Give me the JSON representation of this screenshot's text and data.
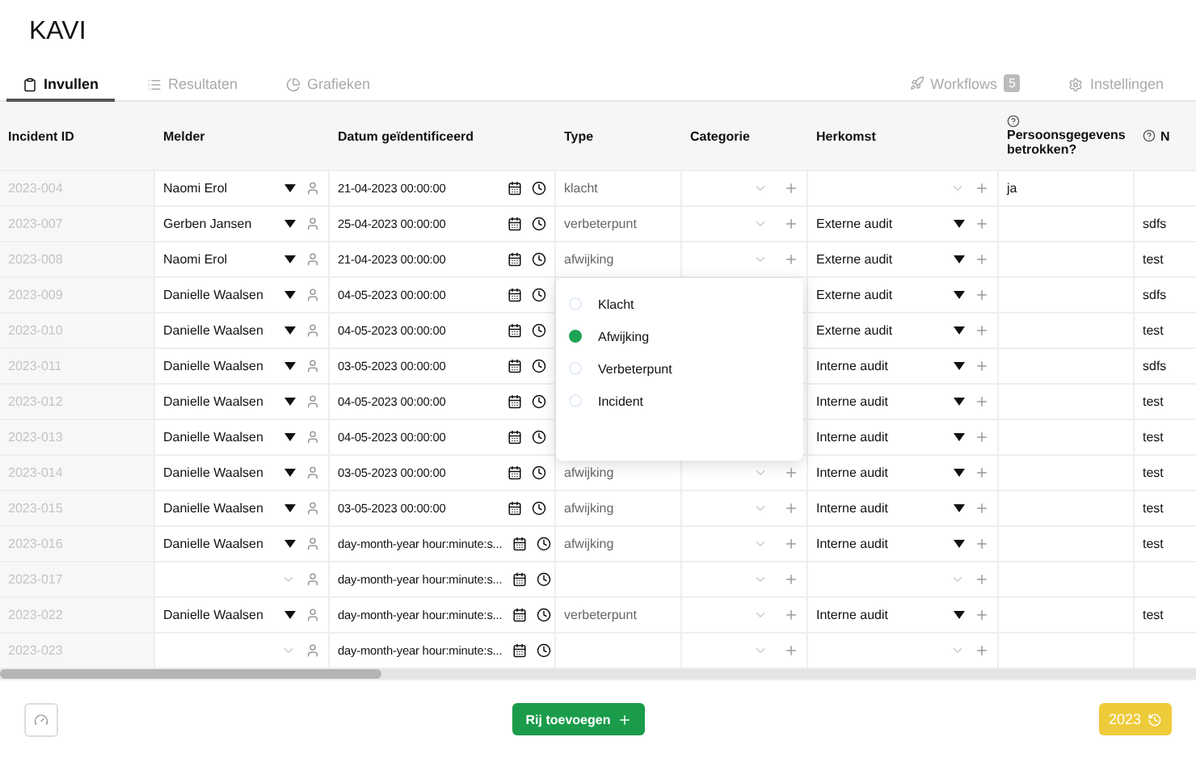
{
  "app_title": "KAVI",
  "tabs": [
    {
      "label": "Invullen",
      "selected": true
    },
    {
      "label": "Resultaten",
      "selected": false
    },
    {
      "label": "Grafieken",
      "selected": false
    }
  ],
  "right_tabs": [
    {
      "label": "Workflows",
      "badge": "5"
    },
    {
      "label": "Instellingen"
    }
  ],
  "table": {
    "columns": [
      {
        "label": "Incident ID"
      },
      {
        "label": "Melder"
      },
      {
        "label": "Datum geïdentificeerd"
      },
      {
        "label": "Type"
      },
      {
        "label": "Categorie"
      },
      {
        "label": "Herkomst"
      },
      {
        "label": "Persoonsgegevens betrokken?",
        "info": true
      },
      {
        "label": "N",
        "info": true
      }
    ],
    "rows": [
      {
        "id": "2023-004",
        "melder": "Naomi Erol",
        "date": "21-04-2023 00:00:00",
        "type": "klacht",
        "herkomst": "",
        "persoons": "ja",
        "notes": ""
      },
      {
        "id": "2023-007",
        "melder": "Gerben Jansen",
        "date": "25-04-2023 00:00:00",
        "type": "verbeterpunt",
        "herkomst": "Externe audit",
        "persoons": "",
        "notes": "sdfs"
      },
      {
        "id": "2023-008",
        "melder": "Naomi Erol",
        "date": "21-04-2023 00:00:00",
        "type": "afwijking",
        "herkomst": "Externe audit",
        "persoons": "",
        "notes": "test"
      },
      {
        "id": "2023-009",
        "melder": "Danielle Waalsen",
        "date": "04-05-2023 00:00:00",
        "herkomst": "Externe audit",
        "persoons": "",
        "notes": "sdfs"
      },
      {
        "id": "2023-010",
        "melder": "Danielle Waalsen",
        "date": "04-05-2023 00:00:00",
        "herkomst": "Externe audit",
        "persoons": "",
        "notes": "test"
      },
      {
        "id": "2023-011",
        "melder": "Danielle Waalsen",
        "date": "03-05-2023 00:00:00",
        "herkomst": "Interne audit",
        "persoons": "",
        "notes": "sdfs"
      },
      {
        "id": "2023-012",
        "melder": "Danielle Waalsen",
        "date": "04-05-2023 00:00:00",
        "herkomst": "Interne audit",
        "persoons": "",
        "notes": "test"
      },
      {
        "id": "2023-013",
        "melder": "Danielle Waalsen",
        "date": "04-05-2023 00:00:00",
        "herkomst": "Interne audit",
        "persoons": "",
        "notes": "test"
      },
      {
        "id": "2023-014",
        "melder": "Danielle Waalsen",
        "date": "03-05-2023 00:00:00",
        "type": "afwijking",
        "herkomst": "Interne audit",
        "persoons": "",
        "notes": "test"
      },
      {
        "id": "2023-015",
        "melder": "Danielle Waalsen",
        "date": "03-05-2023 00:00:00",
        "type": "afwijking",
        "herkomst": "Interne audit",
        "persoons": "",
        "notes": "test"
      },
      {
        "id": "2023-016",
        "melder": "Danielle Waalsen",
        "date": "day-month-year hour:minute:s...",
        "type": "afwijking",
        "herkomst": "Interne audit",
        "persoons": "",
        "notes": "test"
      },
      {
        "id": "2023-017",
        "melder": "",
        "date": "day-month-year hour:minute:s...",
        "type": "",
        "herkomst": "",
        "persoons": "",
        "notes": ""
      },
      {
        "id": "2023-022",
        "melder": "Danielle Waalsen",
        "date": "day-month-year hour:minute:s...",
        "type": "verbeterpunt",
        "herkomst": "Interne audit",
        "persoons": "",
        "notes": "test"
      },
      {
        "id": "2023-023",
        "melder": "",
        "date": "day-month-year hour:minute:s...",
        "type": "",
        "herkomst": "",
        "persoons": "",
        "notes": ""
      }
    ]
  },
  "type_menu": {
    "options": [
      {
        "label": "Klacht",
        "selected": false
      },
      {
        "label": "Afwijking",
        "selected": true
      },
      {
        "label": "Verbeterpunt",
        "selected": false
      },
      {
        "label": "Incident",
        "selected": false
      }
    ]
  },
  "footer": {
    "add_button": "Rij toevoegen",
    "year_button": "2023"
  }
}
